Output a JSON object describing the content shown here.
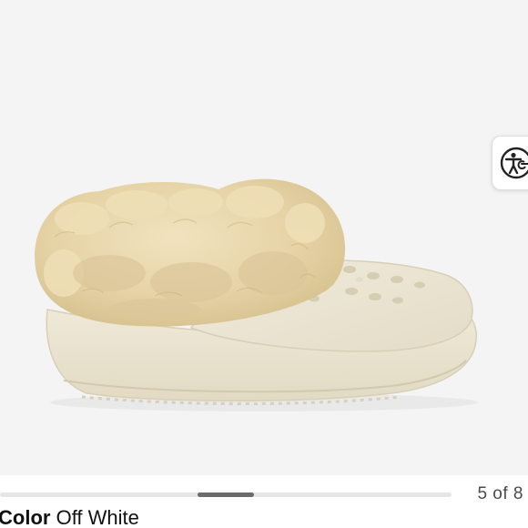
{
  "gallery": {
    "image_alt": "Crocs fur-lined platform clog in off white",
    "counter": "5 of 8",
    "current_index": 5,
    "total_images": 8,
    "scroll_position_fraction": 0.5
  },
  "accessibility": {
    "icon": "accessibility-person-icon"
  },
  "product": {
    "color_label": "Color",
    "color_value": "Off White"
  },
  "colors": {
    "photo_background": "#f4f4f4",
    "shoe_body": "#ece6d4",
    "fur": "#e8d7ad",
    "scroll_thumb": "#6b6b6b",
    "scroll_track": "#e6e6e6"
  }
}
